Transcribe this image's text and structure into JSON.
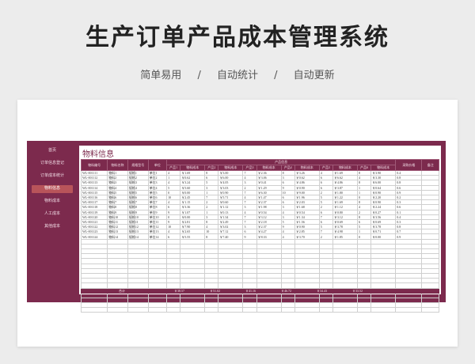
{
  "page": {
    "title": "生产订单产品成本管理系统",
    "features": [
      "简单易用",
      "自动统计",
      "自动更新"
    ],
    "separator": "/"
  },
  "sidebar": {
    "items": [
      "首页",
      "订单信息登记",
      "订单成本统计",
      "物料信息",
      "物料成本",
      "人工成本",
      "其他成本"
    ],
    "active_index": 3
  },
  "main": {
    "title": "物料信息",
    "group_header": "产品信息",
    "columns": [
      "物料编号",
      "物料名称",
      "规格型号",
      "单位",
      "产品1",
      "物料成本",
      "产品2",
      "物料成本",
      "产品3",
      "物料成本",
      "产品4",
      "物料成本",
      "产品5",
      "物料成本",
      "产品6",
      "物料成本",
      "采购价格",
      "备注"
    ],
    "rows": [
      [
        "WL-001111",
        "物料1",
        "规格1",
        "单位1",
        "4",
        "￥1.69",
        "8",
        "￥3.00",
        "7",
        "￥2.36",
        "8",
        "￥3.26",
        "4",
        "￥1.69",
        "8",
        "￥3.90",
        "0.4",
        ""
      ],
      [
        "WL-001112",
        "物料2",
        "规格2",
        "单位2",
        "1",
        "￥0.62",
        "6",
        "￥6.00",
        "4",
        "￥3.06",
        "3",
        "￥0.62",
        "6",
        "￥6.62",
        "4",
        "￥3.30",
        "0.8",
        ""
      ],
      [
        "WL-001113",
        "物料3",
        "规格3",
        "单位3",
        "4",
        "￥3.24",
        "5",
        "￥4.05",
        "3",
        "￥0.41",
        "6",
        "￥4.86",
        "6",
        "￥4.86",
        "8",
        "￥6.00",
        "0.8",
        ""
      ],
      [
        "WL-001114",
        "物料4",
        "规格4",
        "单位4",
        "5",
        "￥5.60",
        "3",
        "￥3.03",
        "2",
        "￥1.29",
        "9",
        "￥0.90",
        "6",
        "￥3.87",
        "1",
        "￥0.64",
        "0.6",
        ""
      ],
      [
        "WL-001115",
        "物料5",
        "规格5",
        "单位5",
        "0",
        "￥0.00",
        "1",
        "￥0.90",
        "7",
        "￥6.30",
        "10",
        "￥9.00",
        "2",
        "￥1.80",
        "1",
        "￥0.90",
        "0.9",
        ""
      ],
      [
        "WL-001116",
        "物料6",
        "规格6",
        "单位6",
        "10",
        "￥2.45",
        "7",
        "￥5.71",
        "4",
        "￥1.47",
        "6",
        "￥1.96",
        "5",
        "￥1.22",
        "0",
        "￥2.20",
        "0.2",
        ""
      ],
      [
        "WL-001117",
        "物料7",
        "规格7",
        "单位7",
        "4",
        "￥1.15",
        "2",
        "￥0.60",
        "7",
        "￥2.37",
        "6",
        "￥2.03",
        "5",
        "￥1.69",
        "8",
        "￥0.90",
        "0.3",
        ""
      ],
      [
        "WL-001118",
        "物料8",
        "规格8",
        "单位8",
        "6",
        "￥3.36",
        "2",
        "￥1.12",
        "3",
        "￥1.98",
        "3",
        "￥1.68",
        "2",
        "￥1.12",
        "4",
        "￥2.24",
        "0.6",
        ""
      ],
      [
        "WL-001119",
        "物料9",
        "规格9",
        "单位9",
        "9",
        "￥1.07",
        "1",
        "￥0.13",
        "4",
        "￥0.54",
        "4",
        "￥0.54",
        "6",
        "￥0.80",
        "2",
        "￥0.27",
        "0.1",
        ""
      ],
      [
        "WL-001120",
        "物料10",
        "规格10",
        "单位10",
        "0",
        "￥0.00",
        "3",
        "￥1.34",
        "7",
        "￥3.12",
        "3",
        "￥1.34",
        "7",
        "￥3.12",
        "8",
        "￥3.56",
        "0.4",
        ""
      ],
      [
        "WL-001121",
        "物料11",
        "规格11",
        "单位11",
        "9",
        "￥2.81",
        "8",
        "￥2.49",
        "7",
        "￥2.18",
        "5",
        "￥1.56",
        "6",
        "￥0.69",
        "6",
        "￥0.69",
        "0.3",
        ""
      ],
      [
        "WL-001122",
        "物料12",
        "规格12",
        "单位12",
        "10",
        "￥7.90",
        "4",
        "￥3.02",
        "3",
        "￥2.37",
        "9",
        "￥0.90",
        "5",
        "￥3.78",
        "5",
        "￥3.78",
        "0.8",
        ""
      ],
      [
        "WL-001123",
        "物料13",
        "规格13",
        "单位13",
        "4",
        "￥2.65",
        "10",
        "￥7.12",
        "6",
        "￥4.27",
        "4",
        "￥2.85",
        "7",
        "￥4.98",
        "1",
        "￥0.71",
        "0.7",
        ""
      ],
      [
        "WL-001124",
        "物料14",
        "规格14",
        "单位14",
        "6",
        "￥5.55",
        "8",
        "￥7.40",
        "9",
        "￥8.33",
        "4",
        "￥3.70",
        "2",
        "￥1.85",
        "0",
        "￥0.00",
        "0.9",
        ""
      ]
    ],
    "blank_row_count": 15,
    "totals": {
      "label": "合计",
      "values": [
        "￥38.57",
        "￥51.02",
        "￥41.16",
        "￥46.72",
        "￥34.43",
        "￥33.52"
      ]
    }
  },
  "colors": {
    "accent": "#7c2a4d",
    "active_nav": "#b8545a",
    "page_bg": "#ececec"
  }
}
